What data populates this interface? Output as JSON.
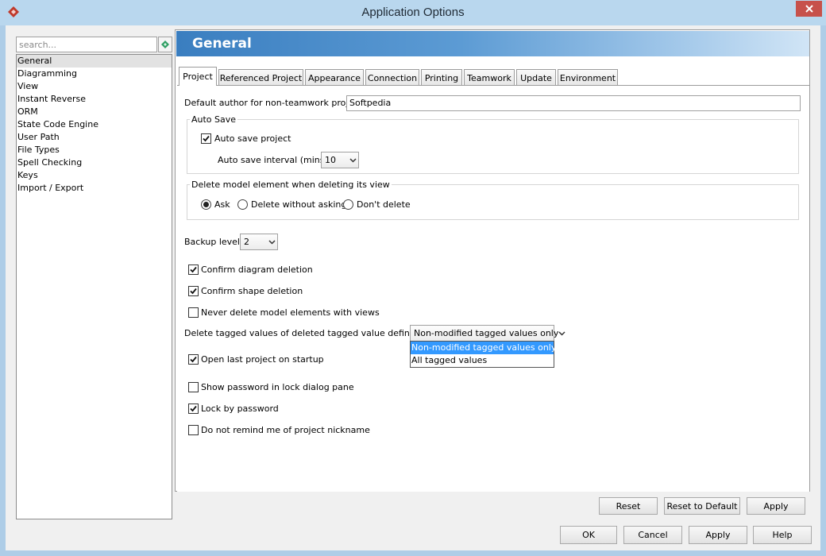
{
  "window": {
    "title": "Application Options"
  },
  "search": {
    "placeholder": "search...",
    "value": ""
  },
  "nav": {
    "items": [
      "General",
      "Diagramming",
      "View",
      "Instant Reverse",
      "ORM",
      "State Code Engine",
      "User Path",
      "File Types",
      "Spell Checking",
      "Keys",
      "Import / Export"
    ],
    "selected": "General"
  },
  "page": {
    "title": "General"
  },
  "tabs": [
    "Project",
    "Referenced Project",
    "Appearance",
    "Connection",
    "Printing",
    "Teamwork",
    "Update",
    "Environment"
  ],
  "active_tab": "Project",
  "project": {
    "default_author_label": "Default author for non-teamwork project:",
    "default_author_value": "Softpedia",
    "auto_save_group": "Auto Save",
    "auto_save_project_label": "Auto save project",
    "auto_save_project_checked": true,
    "auto_save_interval_label": "Auto save interval (mins) :",
    "auto_save_interval_value": "10",
    "delete_group": "Delete model element when deleting its view",
    "delete_options": [
      "Ask",
      "Delete without asking",
      "Don't delete"
    ],
    "delete_selected": "Ask",
    "backup_label": "Backup level :",
    "backup_value": "2",
    "confirm_diagram_label": "Confirm diagram deletion",
    "confirm_diagram_checked": true,
    "confirm_shape_label": "Confirm shape deletion",
    "confirm_shape_checked": true,
    "never_delete_label": "Never delete model elements with views",
    "never_delete_checked": false,
    "tagged_values_label": "Delete tagged values of deleted tagged value definitions :",
    "tagged_values_value": "Non-modified tagged values only",
    "tagged_values_options": [
      "Non-modified tagged values only",
      "All tagged values"
    ],
    "open_last_label": "Open last project on startup",
    "open_last_checked": true,
    "show_password_label": "Show password in lock dialog pane",
    "show_password_checked": false,
    "lock_password_label": "Lock by password",
    "lock_password_checked": true,
    "no_remind_label": "Do not remind me of project nickname",
    "no_remind_checked": false
  },
  "panel_buttons": {
    "reset": "Reset",
    "reset_default": "Reset to Default",
    "apply": "Apply"
  },
  "dialog_buttons": {
    "ok": "OK",
    "cancel": "Cancel",
    "apply": "Apply",
    "help": "Help"
  },
  "colors": {
    "accent": "#3a7ec0",
    "selection": "#3399ff",
    "close": "#c7514b"
  }
}
